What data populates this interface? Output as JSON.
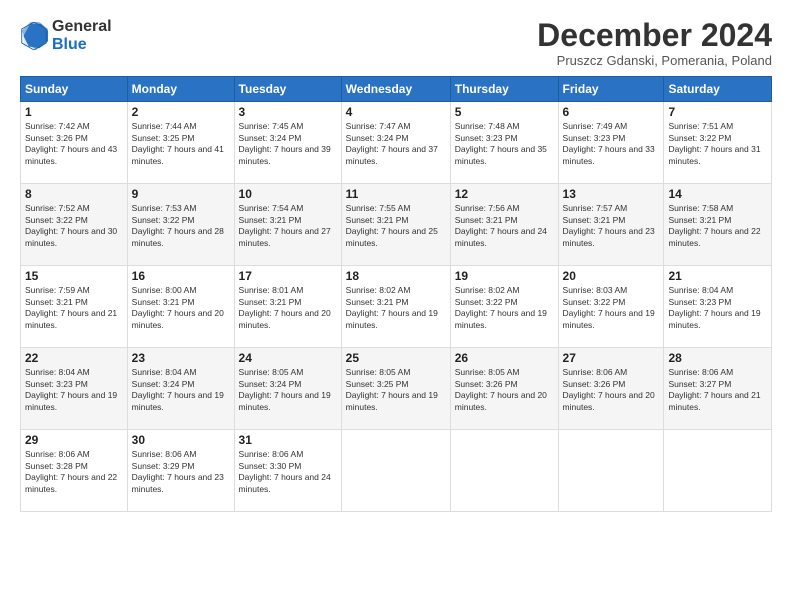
{
  "logo": {
    "general": "General",
    "blue": "Blue"
  },
  "title": "December 2024",
  "subtitle": "Pruszcz Gdanski, Pomerania, Poland",
  "days_of_week": [
    "Sunday",
    "Monday",
    "Tuesday",
    "Wednesday",
    "Thursday",
    "Friday",
    "Saturday"
  ],
  "weeks": [
    [
      {
        "day": "1",
        "sunrise": "7:42 AM",
        "sunset": "3:26 PM",
        "daylight": "7 hours and 43 minutes."
      },
      {
        "day": "2",
        "sunrise": "7:44 AM",
        "sunset": "3:25 PM",
        "daylight": "7 hours and 41 minutes."
      },
      {
        "day": "3",
        "sunrise": "7:45 AM",
        "sunset": "3:24 PM",
        "daylight": "7 hours and 39 minutes."
      },
      {
        "day": "4",
        "sunrise": "7:47 AM",
        "sunset": "3:24 PM",
        "daylight": "7 hours and 37 minutes."
      },
      {
        "day": "5",
        "sunrise": "7:48 AM",
        "sunset": "3:23 PM",
        "daylight": "7 hours and 35 minutes."
      },
      {
        "day": "6",
        "sunrise": "7:49 AM",
        "sunset": "3:23 PM",
        "daylight": "7 hours and 33 minutes."
      },
      {
        "day": "7",
        "sunrise": "7:51 AM",
        "sunset": "3:22 PM",
        "daylight": "7 hours and 31 minutes."
      }
    ],
    [
      {
        "day": "8",
        "sunrise": "7:52 AM",
        "sunset": "3:22 PM",
        "daylight": "7 hours and 30 minutes."
      },
      {
        "day": "9",
        "sunrise": "7:53 AM",
        "sunset": "3:22 PM",
        "daylight": "7 hours and 28 minutes."
      },
      {
        "day": "10",
        "sunrise": "7:54 AM",
        "sunset": "3:21 PM",
        "daylight": "7 hours and 27 minutes."
      },
      {
        "day": "11",
        "sunrise": "7:55 AM",
        "sunset": "3:21 PM",
        "daylight": "7 hours and 25 minutes."
      },
      {
        "day": "12",
        "sunrise": "7:56 AM",
        "sunset": "3:21 PM",
        "daylight": "7 hours and 24 minutes."
      },
      {
        "day": "13",
        "sunrise": "7:57 AM",
        "sunset": "3:21 PM",
        "daylight": "7 hours and 23 minutes."
      },
      {
        "day": "14",
        "sunrise": "7:58 AM",
        "sunset": "3:21 PM",
        "daylight": "7 hours and 22 minutes."
      }
    ],
    [
      {
        "day": "15",
        "sunrise": "7:59 AM",
        "sunset": "3:21 PM",
        "daylight": "7 hours and 21 minutes."
      },
      {
        "day": "16",
        "sunrise": "8:00 AM",
        "sunset": "3:21 PM",
        "daylight": "7 hours and 20 minutes."
      },
      {
        "day": "17",
        "sunrise": "8:01 AM",
        "sunset": "3:21 PM",
        "daylight": "7 hours and 20 minutes."
      },
      {
        "day": "18",
        "sunrise": "8:02 AM",
        "sunset": "3:21 PM",
        "daylight": "7 hours and 19 minutes."
      },
      {
        "day": "19",
        "sunrise": "8:02 AM",
        "sunset": "3:22 PM",
        "daylight": "7 hours and 19 minutes."
      },
      {
        "day": "20",
        "sunrise": "8:03 AM",
        "sunset": "3:22 PM",
        "daylight": "7 hours and 19 minutes."
      },
      {
        "day": "21",
        "sunrise": "8:04 AM",
        "sunset": "3:23 PM",
        "daylight": "7 hours and 19 minutes."
      }
    ],
    [
      {
        "day": "22",
        "sunrise": "8:04 AM",
        "sunset": "3:23 PM",
        "daylight": "7 hours and 19 minutes."
      },
      {
        "day": "23",
        "sunrise": "8:04 AM",
        "sunset": "3:24 PM",
        "daylight": "7 hours and 19 minutes."
      },
      {
        "day": "24",
        "sunrise": "8:05 AM",
        "sunset": "3:24 PM",
        "daylight": "7 hours and 19 minutes."
      },
      {
        "day": "25",
        "sunrise": "8:05 AM",
        "sunset": "3:25 PM",
        "daylight": "7 hours and 19 minutes."
      },
      {
        "day": "26",
        "sunrise": "8:05 AM",
        "sunset": "3:26 PM",
        "daylight": "7 hours and 20 minutes."
      },
      {
        "day": "27",
        "sunrise": "8:06 AM",
        "sunset": "3:26 PM",
        "daylight": "7 hours and 20 minutes."
      },
      {
        "day": "28",
        "sunrise": "8:06 AM",
        "sunset": "3:27 PM",
        "daylight": "7 hours and 21 minutes."
      }
    ],
    [
      {
        "day": "29",
        "sunrise": "8:06 AM",
        "sunset": "3:28 PM",
        "daylight": "7 hours and 22 minutes."
      },
      {
        "day": "30",
        "sunrise": "8:06 AM",
        "sunset": "3:29 PM",
        "daylight": "7 hours and 23 minutes."
      },
      {
        "day": "31",
        "sunrise": "8:06 AM",
        "sunset": "3:30 PM",
        "daylight": "7 hours and 24 minutes."
      },
      null,
      null,
      null,
      null
    ]
  ],
  "labels": {
    "sunrise": "Sunrise:",
    "sunset": "Sunset:",
    "daylight": "Daylight:"
  }
}
